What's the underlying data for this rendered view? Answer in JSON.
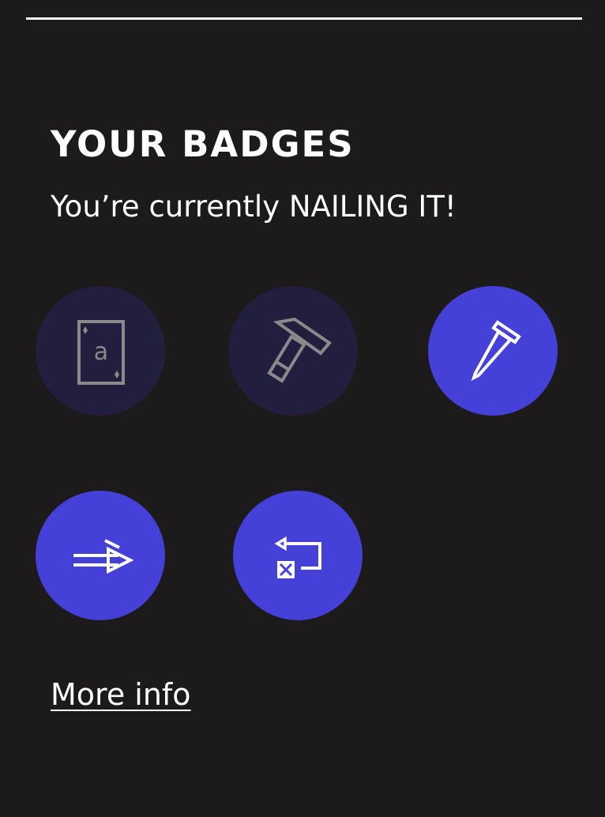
{
  "section": {
    "title": "YOUR BADGES",
    "status_text": "You’re currently NAILING IT!"
  },
  "colors": {
    "background": "#1c1a1b",
    "locked_badge": "#221f3e",
    "earned_badge": "#4440d8",
    "locked_icon": "#8a8a8a",
    "earned_icon": "#ffffff"
  },
  "badges": [
    {
      "icon": "playing-card-icon",
      "earned": false,
      "card_letter": "a"
    },
    {
      "icon": "hammer-icon",
      "earned": false
    },
    {
      "icon": "nail-icon",
      "earned": true
    },
    {
      "icon": "fast-forward-arrow-icon",
      "earned": true
    },
    {
      "icon": "loop-flow-icon",
      "earned": true
    }
  ],
  "links": {
    "more_info": "More info"
  }
}
